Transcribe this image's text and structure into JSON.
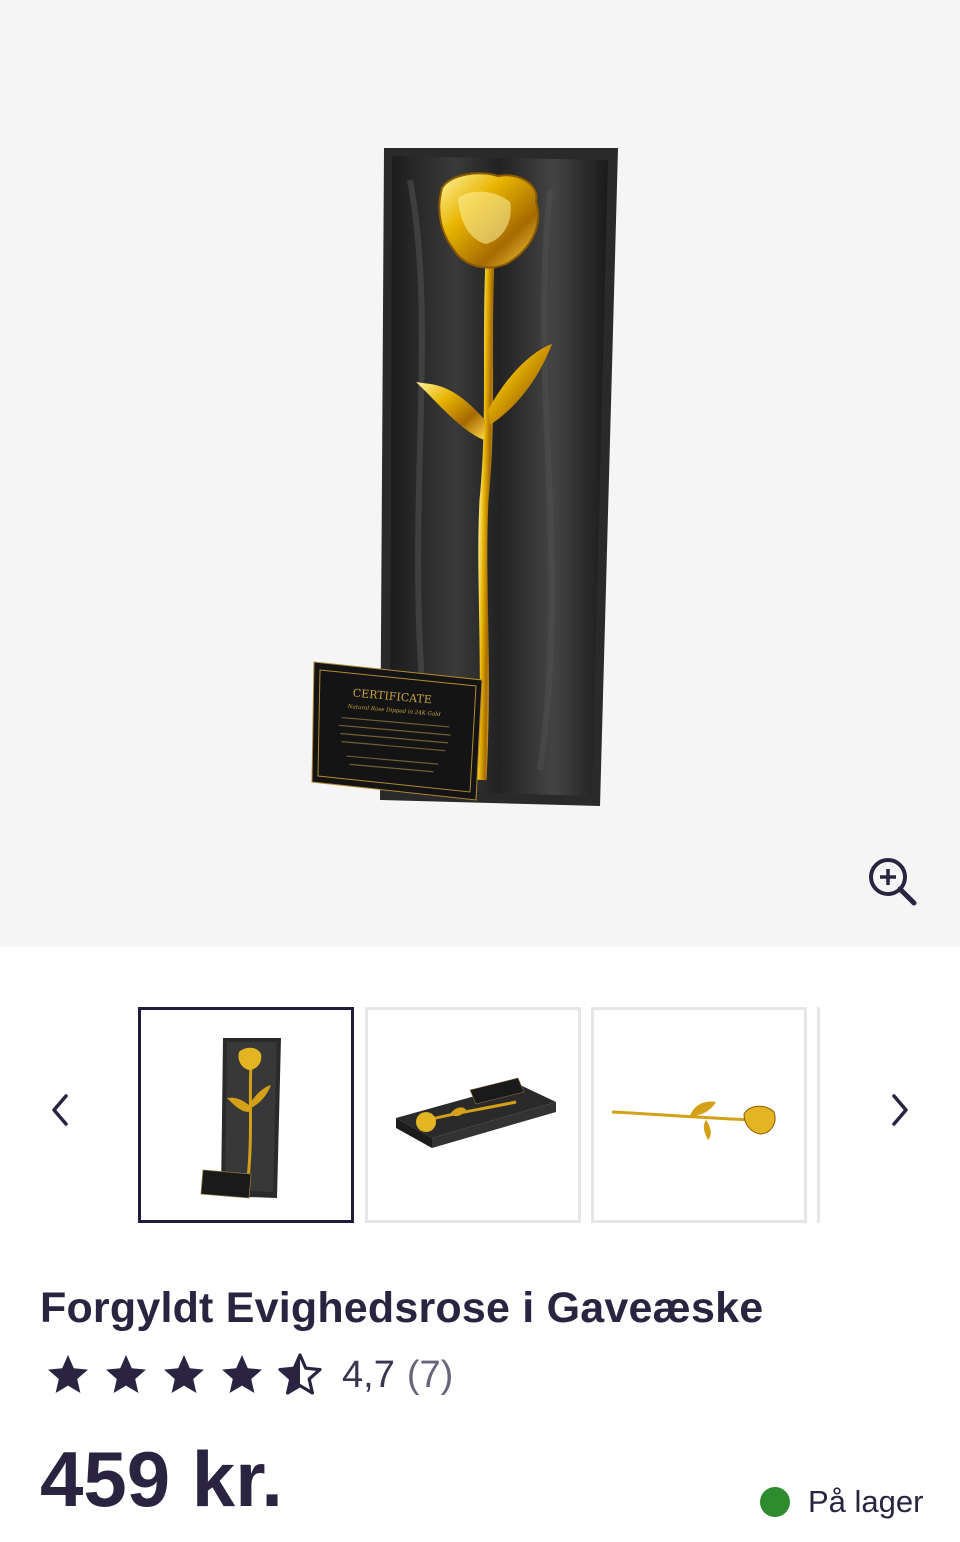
{
  "product": {
    "title": "Forgyldt Evighedsrose i Gaveæske",
    "rating_value": "4,7",
    "rating_count": "(7)",
    "rating_stars": 4.5,
    "price": "459 kr.",
    "stock_status": "På lager",
    "stock_color": "#2e8b2e"
  },
  "certificate": {
    "heading": "CERTIFICATE",
    "subheading": "Natural Rose Dipped in 24K Gold"
  },
  "gallery": {
    "thumbnail_count": 3,
    "active_index": 0,
    "icons": {
      "zoom": "zoom-in-icon",
      "prev": "chevron-left-icon",
      "next": "chevron-right-icon"
    }
  },
  "colors": {
    "text": "#2a2440",
    "accent_border": "#221a3a",
    "gold": "#d4a017"
  }
}
